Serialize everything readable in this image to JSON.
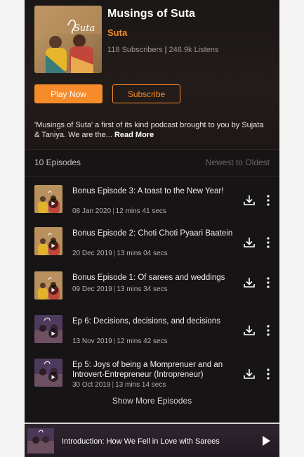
{
  "podcast": {
    "title": "Musings of Suta",
    "author": "Suta",
    "subscribers": "118 Subscribers",
    "listens": "246.9k Listens",
    "cover_logo_text": "Suta",
    "play_label": "Play Now",
    "subscribe_label": "Subscribe",
    "description": "'Musings of Suta' a first of its kind podcast brought to you by Sujata & Taniya. We are the...",
    "read_more": "Read More"
  },
  "episodes_header": {
    "count": "10 Episodes",
    "sort": "Newest to Oldest"
  },
  "episodes": [
    {
      "title": "Bonus Episode 3: A toast to the New Year!",
      "date": "08 Jan 2020",
      "duration": "12 mins 41 secs",
      "thumb": "cover-yellow"
    },
    {
      "title": "Bonus Episode 2: Choti Choti Pyaari Baatein",
      "date": "20 Dec 2019",
      "duration": "13 mins 04 secs",
      "thumb": "cover-yellow"
    },
    {
      "title": "Bonus Episode 1: Of sarees and weddings",
      "date": "09 Dec 2019",
      "duration": "13 mins 34 secs",
      "thumb": "cover-yellow"
    },
    {
      "title": "Ep 6: Decisions, decisions, and decisions",
      "date": "13 Nov 2019",
      "duration": "12 mins 42 secs",
      "thumb": "cover-purple"
    },
    {
      "title": "Ep 5: Joys of being a Momprenuer and an Introvert-Entrepreneur (Intropreneur)",
      "date": "30 Oct 2019",
      "duration": "13 mins 14 secs",
      "thumb": "cover-purple"
    }
  ],
  "show_more": "Show More Episodes",
  "now_playing": {
    "title": "Introduction: How We Fell in Love with Sarees"
  },
  "icons": {
    "download": "download-icon",
    "more": "kebab-menu-icon",
    "play": "play-icon"
  },
  "colors": {
    "accent": "#f68b2a",
    "background": "#161414",
    "text": "#f3efec"
  }
}
